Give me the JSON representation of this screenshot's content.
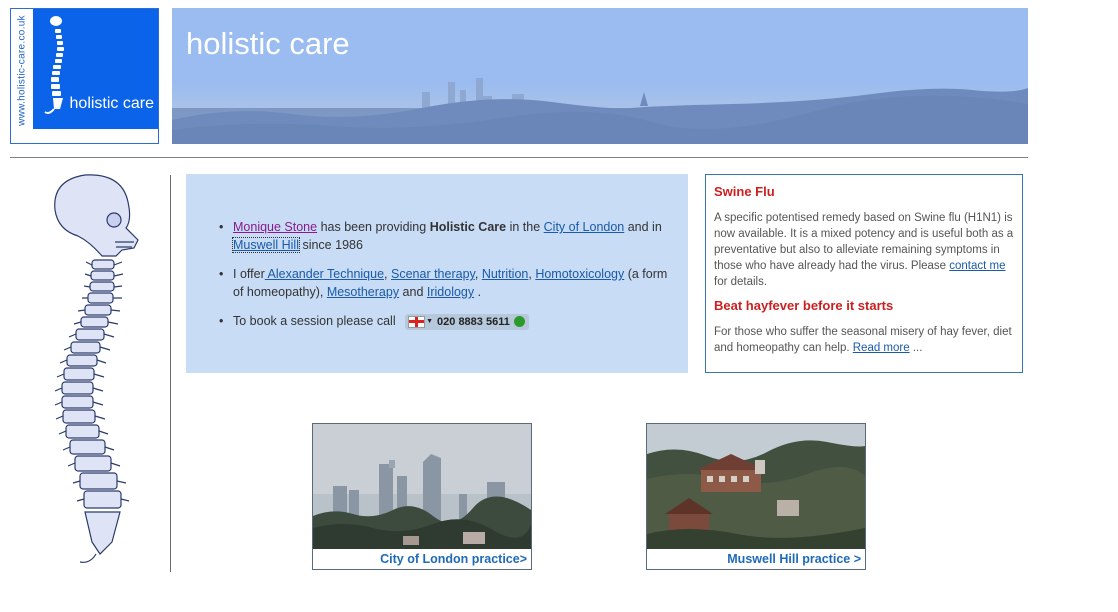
{
  "logo": {
    "url_text": "www.holistic-care.co.uk",
    "brand": "holistic care"
  },
  "banner": {
    "title": "holistic care"
  },
  "intro": {
    "items": [
      {
        "bullet": "•",
        "link_person": "Monique Stone",
        "text_a": " has been providing ",
        "bold": "Holistic Care",
        "text_b": " in the ",
        "link_city": "City of London",
        "text_c": " and in ",
        "link_muswell": "Muswell Hill",
        "text_d": " since 1986"
      },
      {
        "bullet": "•",
        "text_a": "I offer",
        "links": [
          " Alexander Technique",
          "Scenar therapy",
          "Nutrition",
          "Homotoxicology"
        ],
        "seps": [
          ", ",
          ", ",
          ", "
        ],
        "text_b": " (a form of homeopathy), ",
        "link_meso": "Mesotherapy",
        "text_c": " and ",
        "link_irid": "Iridology",
        "text_d": " ."
      },
      {
        "bullet": "•",
        "text_a": "To book a session please call",
        "phone": "020 8883 5611"
      }
    ]
  },
  "news": {
    "h1": "Swine Flu",
    "p1_text": "A specific potentised remedy based on Swine flu (H1N1) is now available. It is a mixed potency and is useful both as a preventative but also to alleviate remaining symptoms in those who have already had the virus. Please ",
    "p1_link": "contact me",
    "p1_tail": " for details.",
    "h2": "Beat hayfever before it starts",
    "p2_text": "For those who suffer the seasonal misery of hay fever, diet and homeopathy can help. ",
    "p2_link": "Read more",
    "p2_tail": " ..."
  },
  "photos": [
    {
      "caption": "City of London practice>"
    },
    {
      "caption": "Muswell Hill practice >"
    }
  ],
  "colors": {
    "accent_blue": "#0a63e8",
    "banner_blue": "#9bbcf0",
    "intro_bg": "#c8dcf6",
    "headline_red": "#cc2020",
    "link_blue": "#1a5aa8"
  }
}
